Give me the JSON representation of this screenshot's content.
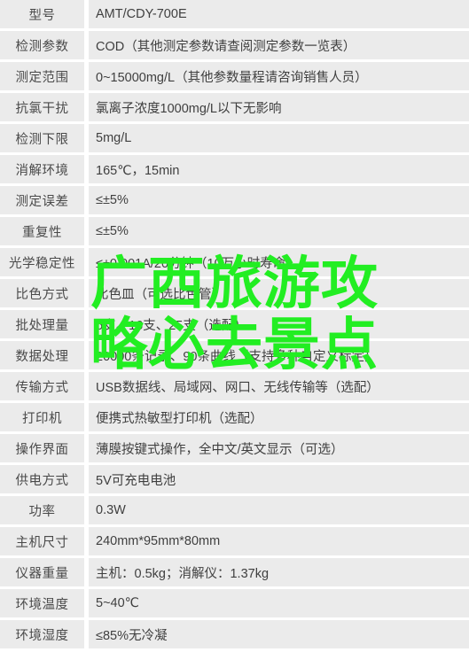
{
  "table": {
    "rows": [
      {
        "label": "型号",
        "value": "AMT/CDY-700E"
      },
      {
        "label": "检测参数",
        "value": "COD（其他测定参数请查阅测定参数一览表）"
      },
      {
        "label": "测定范围",
        "value": "0~15000mg/L（其他参数量程请咨询销售人员）"
      },
      {
        "label": "抗氯干扰",
        "value": "氯离子浓度1000mg/L以下无影响"
      },
      {
        "label": "检测下限",
        "value": "5mg/L"
      },
      {
        "label": "消解环境",
        "value": "165℃，15min"
      },
      {
        "label": "测定误差",
        "value": "≤±5%"
      },
      {
        "label": "重复性",
        "value": "≤±5%"
      },
      {
        "label": "光学稳定性",
        "value": "≤±0.001A/20分钟（10万小时寿命）"
      },
      {
        "label": "比色方式",
        "value": "比色皿（可选比色管）"
      },
      {
        "label": "批处理量",
        "value": "6支、16支、25支（选配）"
      },
      {
        "label": "数据处理",
        "value": "20000条记录、90条曲线（支持多种自定义标定）"
      },
      {
        "label": "传输方式",
        "value": "USB数据线、局域网、网口、无线传输等（选配）"
      },
      {
        "label": "打印机",
        "value": "便携式热敏型打印机（选配）"
      },
      {
        "label": "操作界面",
        "value": "薄膜按键式操作，全中文/英文显示（可选）"
      },
      {
        "label": "供电方式",
        "value": "5V可充电电池"
      },
      {
        "label": "功率",
        "value": "0.3W"
      },
      {
        "label": "主机尺寸",
        "value": "240mm*95mm*80mm"
      },
      {
        "label": "仪器重量",
        "value": "主机：0.5kg；消解仪：1.37kg"
      },
      {
        "label": "环境温度",
        "value": "5~40℃"
      },
      {
        "label": "环境湿度",
        "value": "≤85%无冷凝"
      }
    ]
  },
  "watermark": {
    "line1": "广西旅游攻",
    "line2": "略必去景点",
    "color": "#22ee22"
  },
  "colors": {
    "cell_background": "#ebebeb",
    "page_background": "#ffffff",
    "label_text": "#4a4a4a",
    "value_text": "#3f3f3f"
  }
}
